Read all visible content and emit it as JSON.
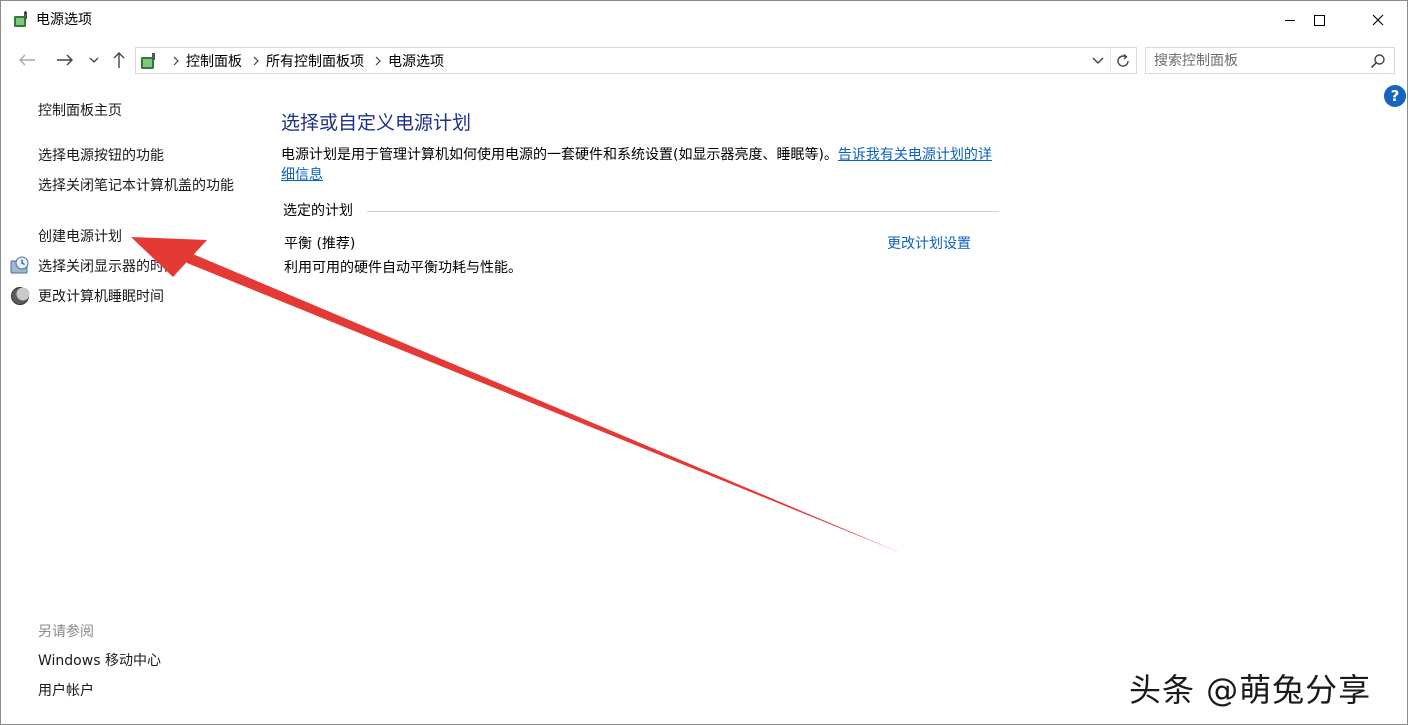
{
  "window": {
    "title": "电源选项"
  },
  "controls": {
    "minimize": "minimize",
    "maximize": "maximize",
    "close": "close"
  },
  "address": {
    "crumbs": [
      "控制面板",
      "所有控制面板项",
      "电源选项"
    ]
  },
  "search": {
    "placeholder": "搜索控制面板"
  },
  "help": {
    "label": "?"
  },
  "left_pane": {
    "home": "控制面板主页",
    "links": [
      "选择电源按钮的功能",
      "选择关闭笔记本计算机盖的功能",
      "创建电源计划",
      "选择关闭显示器的时间",
      "更改计算机睡眠时间"
    ],
    "see_also_label": "另请参阅",
    "see_also": [
      "Windows 移动中心",
      "用户帐户"
    ]
  },
  "main": {
    "title": "选择或自定义电源计划",
    "description": "电源计划是用于管理计算机如何使用电源的一套硬件和系统设置(如显示器亮度、睡眠等)。",
    "description_link": "告诉我有关电源计划的详细信息",
    "section_label": "选定的计划",
    "plan_name": "平衡 (推荐)",
    "plan_description": "利用可用的硬件自动平衡功耗与性能。",
    "plan_change": "更改计划设置"
  },
  "watermark": "头条 @萌兔分享",
  "colors": {
    "title_blue": "#1e3287",
    "link_blue": "#0b62c4",
    "arrow_red": "#e53935"
  }
}
